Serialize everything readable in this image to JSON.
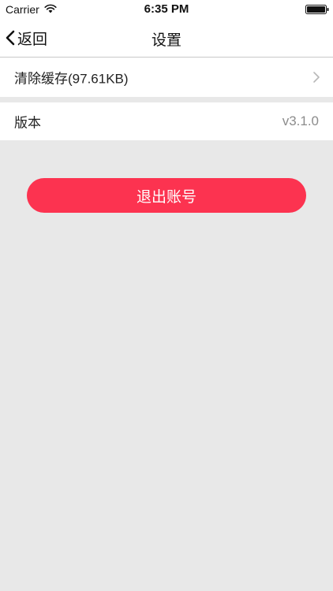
{
  "status_bar": {
    "carrier": "Carrier",
    "time": "6:35 PM",
    "wifi_icon": "wifi-icon",
    "battery_icon": "battery-icon"
  },
  "nav": {
    "back_label": "返回",
    "back_icon": "chevron-left-icon",
    "title": "设置"
  },
  "settings": {
    "clear_cache_label": "清除缓存(97.61KB)",
    "clear_cache_icon": "chevron-right-icon",
    "version_label": "版本",
    "version_value": "v3.1.0"
  },
  "logout": {
    "label": "退出账号"
  },
  "colors": {
    "accent": "#fc3350",
    "background": "#e8e8e8",
    "muted_text": "#8c8c8c"
  }
}
